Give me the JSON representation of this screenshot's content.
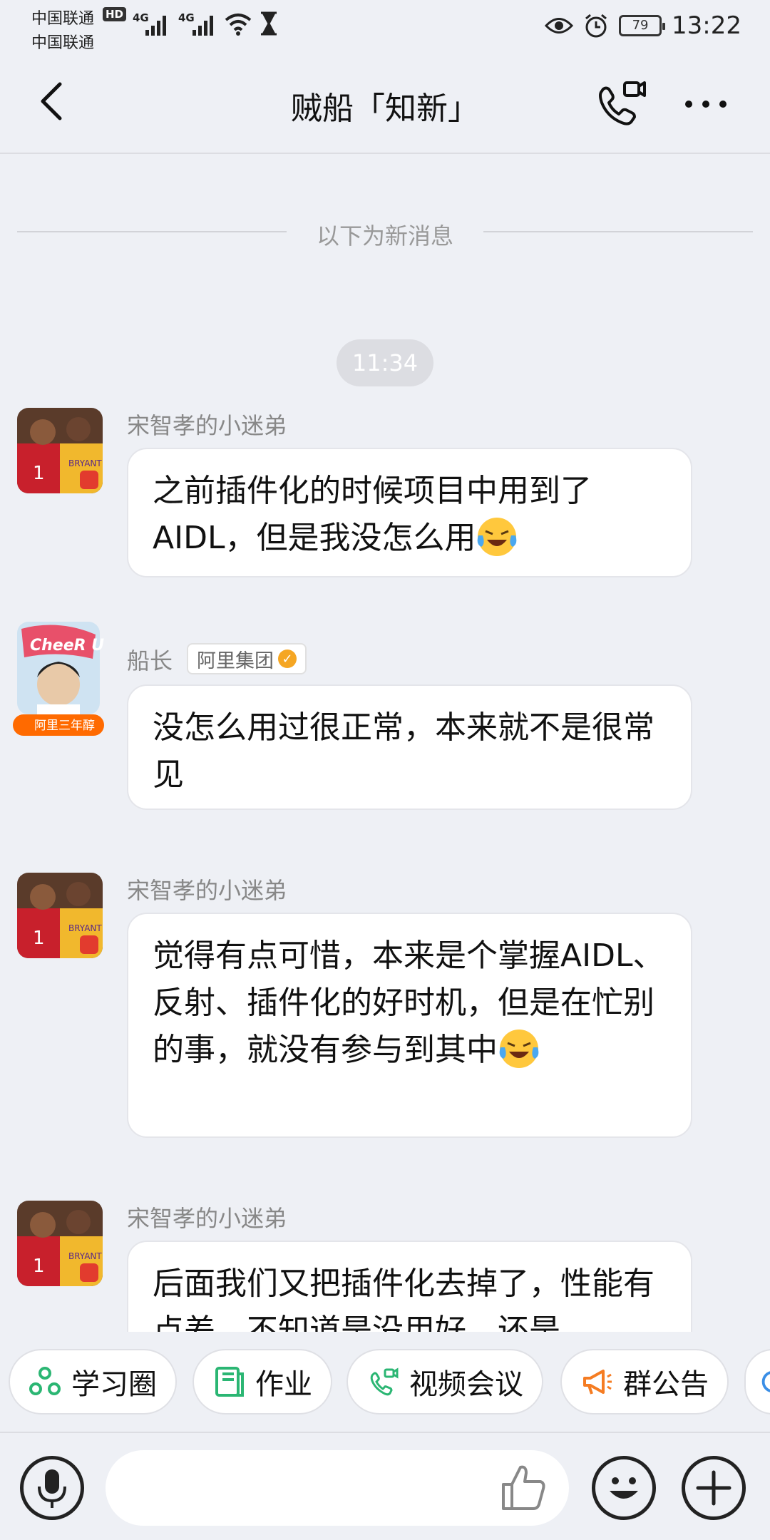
{
  "status_bar": {
    "carrier_1": "中国联通",
    "carrier_2": "中国联通",
    "hd": "HD",
    "net_1": "4G",
    "net_2": "4G",
    "battery": "79",
    "battery_level": 0.79,
    "time": "13:22",
    "icons": [
      "signal-icon",
      "wifi-icon",
      "hourglass-icon",
      "eye-icon",
      "alarm-icon",
      "battery-icon"
    ]
  },
  "header": {
    "title": "贼船「知新」",
    "icons": [
      "back-arrow-icon",
      "video-call-icon",
      "more-icon"
    ]
  },
  "divider": {
    "label": "以下为新消息"
  },
  "timestamp": "11:34",
  "messages": [
    {
      "sender": "宋智孝的小迷弟",
      "text": "之前插件化的时候项目中用到了AIDL，但是我没怎么用",
      "emoji": "crying-laughing-emoji"
    },
    {
      "sender": "船长",
      "badge": "阿里集团",
      "avatar_banner": "阿里三年醇",
      "avatar_caption": "CheeR UP!",
      "text": "没怎么用过很正常，本来就不是很常见"
    },
    {
      "sender": "宋智孝的小迷弟",
      "text": "觉得有点可惜，本来是个掌握AIDL、反射、插件化的好时机，但是在忙别的事，就没有参与到其中",
      "emoji": "crying-laughing-emoji"
    },
    {
      "sender": "宋智孝的小迷弟",
      "text": "后面我们又把插件化去掉了，性能有点差，不知道是没用好，还是"
    }
  ],
  "quick_actions": [
    {
      "label": "学习圈",
      "icon": "study-circle-icon",
      "color": "#2bb673"
    },
    {
      "label": "作业",
      "icon": "homework-book-icon",
      "color": "#2bb673"
    },
    {
      "label": "视频会议",
      "icon": "video-meeting-icon",
      "color": "#2bb673"
    },
    {
      "label": "群公告",
      "icon": "megaphone-icon",
      "color": "#f57c22"
    }
  ],
  "input_bar": {
    "placeholder": "",
    "icons": [
      "microphone-icon",
      "thumbs-up-icon",
      "emoji-face-icon",
      "plus-icon"
    ]
  },
  "colors": {
    "background": "#eef0f5",
    "bubble": "#ffffff",
    "accent_green": "#2bb673",
    "accent_orange": "#f57c22"
  }
}
